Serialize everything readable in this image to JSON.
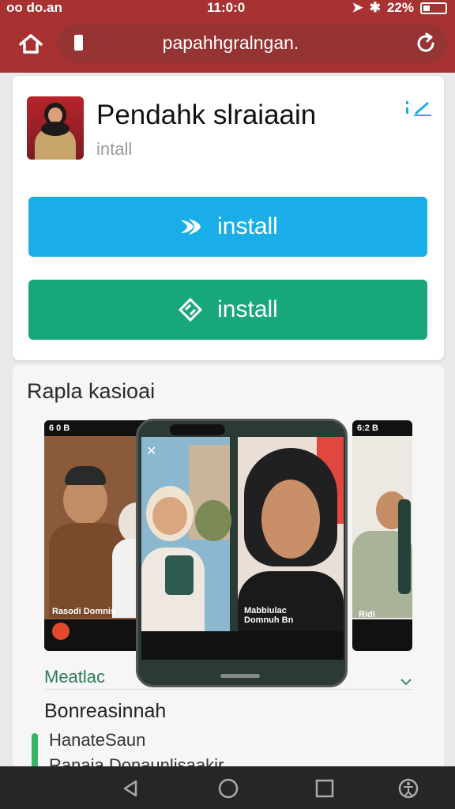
{
  "status": {
    "carrier": "oo do.an",
    "time": "11:0:0",
    "battery": "22%"
  },
  "browser": {
    "url": "papahhgralngan."
  },
  "app": {
    "title": "Pendahk slraiaain",
    "subtitle": "intall",
    "install_primary": "install",
    "install_secondary": "install"
  },
  "screenshots": {
    "section_title": "Rapla kasioai",
    "shot1_status": "6 0 B",
    "shot1_caption": "Rasodi Domnis",
    "phone_caption": "Mabbiulac Domnuh Bn",
    "shot3_status": "6:2 B",
    "shot3_caption": "Ridl"
  },
  "details": {
    "link": "Meatlac",
    "heading": "Bonreasinnah",
    "item1": "HanateSaun",
    "item2": "Ranaia Donaunlisaakir"
  },
  "colors": {
    "chrome": "#a83232",
    "install_blue": "#1aaee8",
    "install_green": "#17a77b",
    "accent_green": "#39b56a"
  }
}
